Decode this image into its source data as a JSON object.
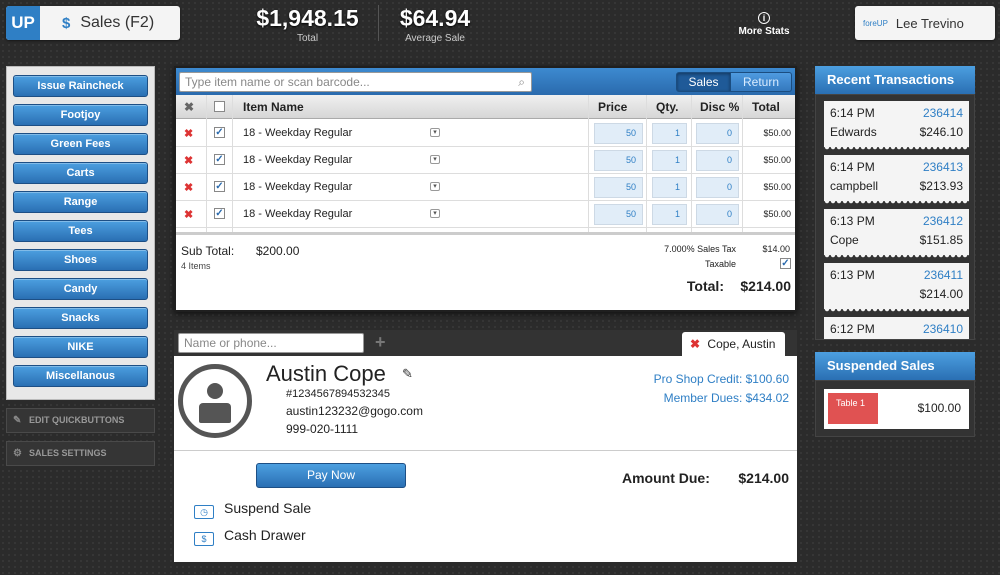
{
  "header": {
    "logo_text": "UP",
    "sales_icon": "$",
    "sales_title": "Sales (F2)",
    "total_value": "$1,948.15",
    "total_label": "Total",
    "avg_value": "$64.94",
    "avg_label": "Average Sale",
    "more_stats_icon": "i",
    "more_stats_label": "More Stats",
    "user_brand": "foreUP",
    "user_name": "Lee Trevino"
  },
  "quick_buttons": [
    "Issue Raincheck",
    "Footjoy",
    "Green Fees",
    "Carts",
    "Range",
    "Tees",
    "Shoes",
    "Candy",
    "Snacks",
    "NIKE",
    "Miscellanous"
  ],
  "side_actions": {
    "edit": "EDIT QUICKBUTTONS",
    "settings": "SALES SETTINGS"
  },
  "cart": {
    "search_placeholder": "Type item name or scan barcode...",
    "mode_sales": "Sales",
    "mode_return": "Return",
    "columns": {
      "remove": "✖",
      "name": "Item Name",
      "price": "Price",
      "qty": "Qty.",
      "disc": "Disc %",
      "total": "Total"
    },
    "items": [
      {
        "name": "18 - Weekday Regular",
        "price": "50",
        "qty": "1",
        "disc": "0",
        "total": "$50.00"
      },
      {
        "name": "18 - Weekday Regular",
        "price": "50",
        "qty": "1",
        "disc": "0",
        "total": "$50.00"
      },
      {
        "name": "18 - Weekday Regular",
        "price": "50",
        "qty": "1",
        "disc": "0",
        "total": "$50.00"
      },
      {
        "name": "18 - Weekday Regular",
        "price": "50",
        "qty": "1",
        "disc": "0",
        "total": "$50.00"
      }
    ],
    "subtotal_label": "Sub Total:",
    "subtotal_value": "$200.00",
    "item_count": "4 Items",
    "tax_label": "7.000% Sales Tax",
    "tax_value": "$14.00",
    "taxable_label": "Taxable",
    "total_label": "Total:",
    "total_value": "$214.00"
  },
  "customer": {
    "search_placeholder": "Name or phone...",
    "add_icon": "+",
    "tab_label": "Cope, Austin",
    "name": "Austin Cope",
    "account": "#1234567894532345",
    "email": "austin123232@gogo.com",
    "phone": "999-020-1111",
    "credit": "Pro Shop Credit: $100.60",
    "dues": "Member Dues: $434.02",
    "pay_label": "Pay Now",
    "amount_due_label": "Amount Due:",
    "amount_due_value": "$214.00",
    "suspend_label": "Suspend Sale",
    "drawer_label": "Cash Drawer"
  },
  "recent": {
    "title": "Recent Transactions",
    "items": [
      {
        "time": "6:14 PM",
        "id": "236414",
        "name": "Edwards",
        "amount": "$246.10"
      },
      {
        "time": "6:14 PM",
        "id": "236413",
        "name": "campbell",
        "amount": "$213.93"
      },
      {
        "time": "6:13 PM",
        "id": "236412",
        "name": "Cope",
        "amount": "$151.85"
      },
      {
        "time": "6:13 PM",
        "id": "236411",
        "name": "",
        "amount": "$214.00"
      },
      {
        "time": "6:12 PM",
        "id": "236410",
        "name": "",
        "amount": ""
      }
    ]
  },
  "suspended": {
    "title": "Suspended Sales",
    "items": [
      {
        "label": "Table 1",
        "amount": "$100.00"
      }
    ]
  },
  "colors": {
    "accent": "#2f7fc5",
    "danger": "#d33333",
    "background": "#2b2b2b"
  }
}
